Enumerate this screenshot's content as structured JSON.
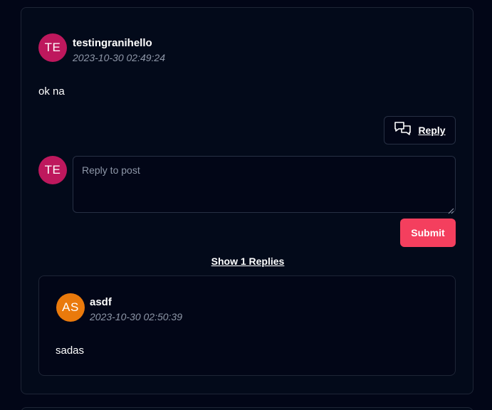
{
  "post": {
    "author": {
      "initials": "TE",
      "name": "testingranihello",
      "avatar_color": "#be185d"
    },
    "timestamp": "2023-10-30 02:49:24",
    "body": "ok na",
    "reply_button_label": "Reply",
    "reply_button_icon": "chat-bubbles-icon",
    "composer": {
      "avatar_initials": "TE",
      "placeholder": "Reply to post",
      "value": "",
      "submit_label": "Submit"
    },
    "show_replies_label": "Show 1 Replies"
  },
  "replies": [
    {
      "author": {
        "initials": "AS",
        "name": "asdf",
        "avatar_color": "#ea7a0c"
      },
      "timestamp": "2023-10-30 02:50:39",
      "body": "sadas"
    }
  ],
  "colors": {
    "background": "#020617",
    "card_border": "#1e2536",
    "accent_submit": "#f43f5e",
    "muted_text": "#8e97a8"
  }
}
